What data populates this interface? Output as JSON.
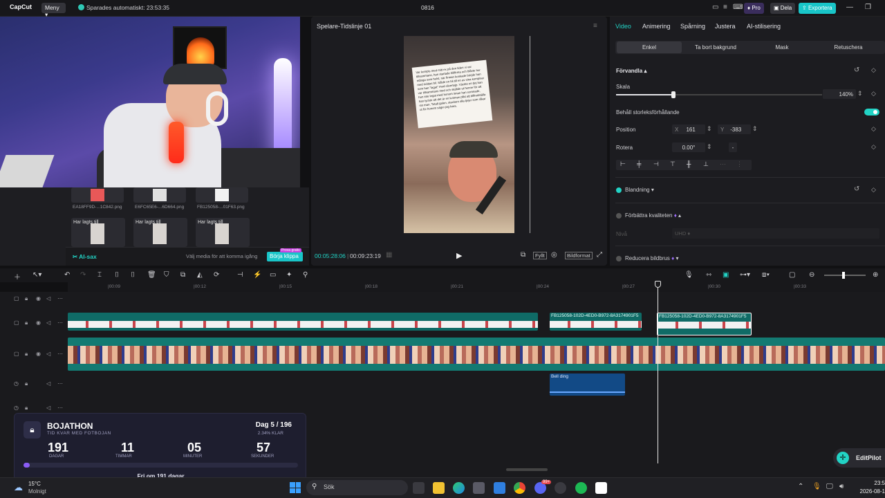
{
  "app": {
    "logo": "CapCut",
    "menu_label": "Meny",
    "autosave": "Sparades automatiskt: 23:53:35",
    "project_title": "0816",
    "pro_label": "Pro",
    "share_label": "Dela",
    "export_label": "Exportera"
  },
  "media": {
    "thumbs": [
      {
        "name": "EA18FF9D-...1C842.png"
      },
      {
        "name": "E6FC65E6-...6D664.png"
      },
      {
        "name": "FB125058-...01F63.png"
      }
    ],
    "added_label": "Har lagts till",
    "ai_label": "AI-sax",
    "hint": "Välj media för att komma igång",
    "start_button": "Börja klippa",
    "trial_badge": "Prova gratis"
  },
  "player": {
    "title": "Spelare-Tidslinje 01",
    "current_time": "00:05:28:06",
    "total_time": "00:09:23:19",
    "fit_label": "Fyllt",
    "ratio_label": "Bildformat",
    "note_text": "Var kompis med mitt ex på den tiden vi var tillsammans, han startade billfirma och blåste hur många som helst, när firman konkade börjde han med tvättas bil. Sålde en bil till en av sina kompisar som han \"lagat\" med silvertejp. Väckte en tjej han var tillsammans med och skällde ut henne för att hon inte legat med honom innan han somnade, han tyckte att det är en kvinnas plikt att tillfredställa sin man. Totalt galen, stackars alla tjejer som råkar ut för honom säger jag bara."
  },
  "props": {
    "tabs": [
      "Video",
      "Animering",
      "Spårning",
      "Justera",
      "AI-stilisering"
    ],
    "subtabs": [
      "Enkel",
      "Ta bort bakgrund",
      "Mask",
      "Retuschera"
    ],
    "transform_title": "Förvandla",
    "scale_label": "Skala",
    "scale_value": "140%",
    "scale_fraction": 0.28,
    "aspect_label": "Behåll storleksförhållande",
    "position_label": "Position",
    "pos_x_label": "X",
    "pos_x": "161",
    "pos_y_label": "Y",
    "pos_y": "-383",
    "rotate_label": "Rotera",
    "rotate_value": "0.00°",
    "blend_label": "Blandning",
    "enhance_label": "Förbättra kvaliteten",
    "level_label": "Nivå",
    "level_value": "UHD",
    "denoise_label": "Reducera bildbrus",
    "accent": "#22d3c5"
  },
  "timeline": {
    "ticks": [
      "|00:09",
      "|00:12",
      "|00:15",
      "|00:18",
      "|00:21",
      "|00:24",
      "|00:27",
      "|00:30",
      "|00:33"
    ],
    "clip_label": "FB125058-102D-4ED0-B972-8A3174901F5",
    "audio_label": "Bell ding"
  },
  "widget": {
    "title": "BOJATHON",
    "subtitle": "TID KVAR MED FOTBOJAN",
    "day": "Dag 5 / 196",
    "percent": "2.34% KLAR",
    "progress": 0.0234,
    "units": [
      {
        "value": "191",
        "label": "DAGAR"
      },
      {
        "value": "11",
        "label": "TIMMAR"
      },
      {
        "value": "05",
        "label": "MINUTER"
      },
      {
        "value": "57",
        "label": "SEKUNDER"
      }
    ],
    "footer": "Fri om 191 dagar"
  },
  "editpilot": "EditPilot",
  "taskbar": {
    "temp": "15°C",
    "weather": "Molnigt",
    "search": "Sök",
    "time": "23:5",
    "date": "2026-08-1",
    "badge": "99+"
  }
}
